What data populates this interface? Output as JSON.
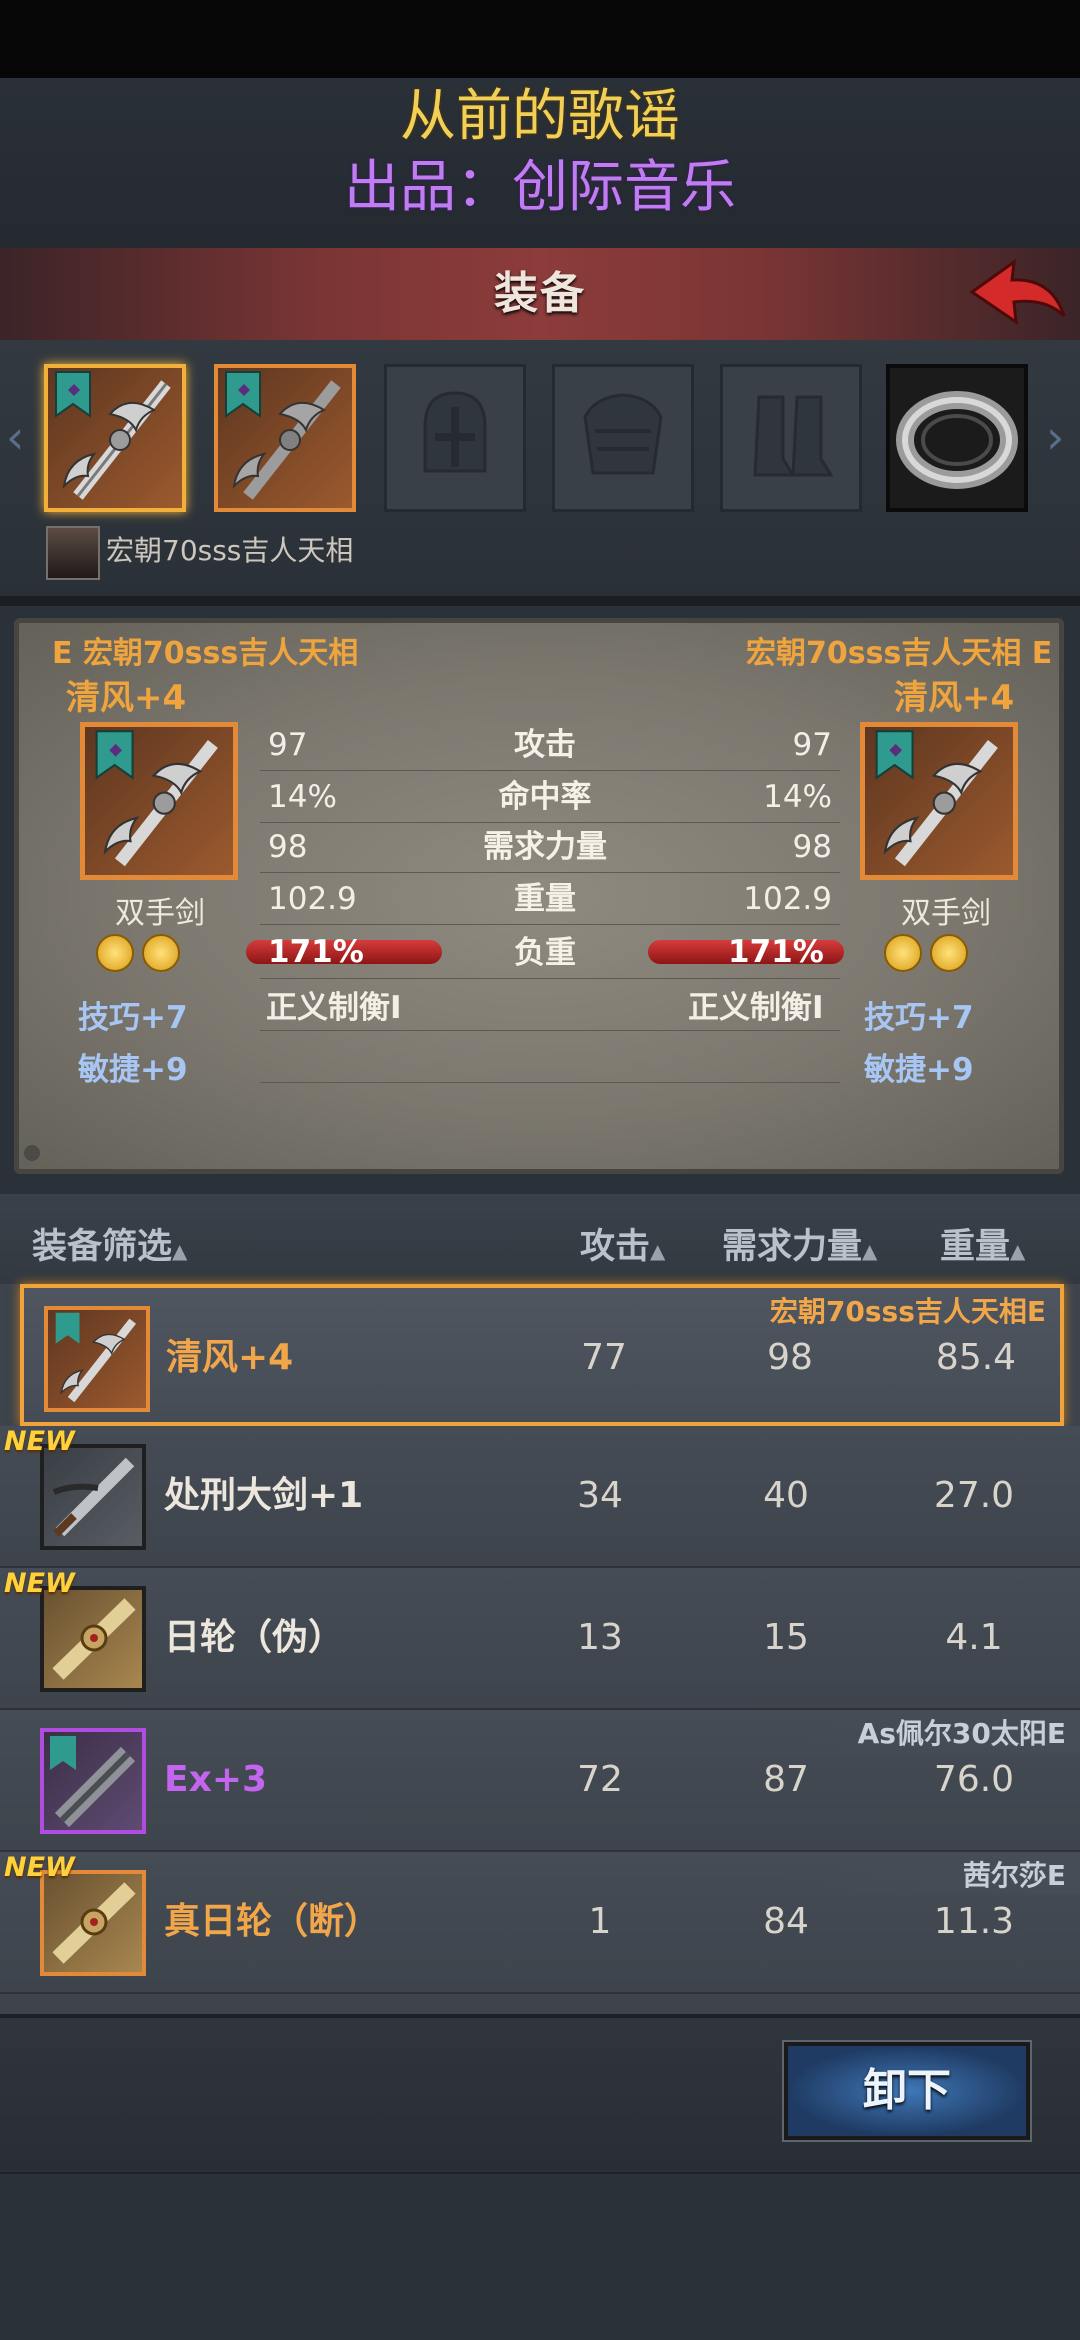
{
  "watermark": {
    "line1": "从前的歌谣",
    "line2": "出品：创际音乐"
  },
  "header": {
    "title": "装备",
    "back_icon": "red-back-arrow-icon"
  },
  "slots": [
    {
      "type": "weapon",
      "icon": "greatsword-icon",
      "selected": true
    },
    {
      "type": "weapon",
      "icon": "greatsword-icon",
      "selected": false
    },
    {
      "type": "empty",
      "icon": "helmet-icon"
    },
    {
      "type": "empty",
      "icon": "armor-icon"
    },
    {
      "type": "empty",
      "icon": "boots-icon"
    },
    {
      "type": "ring",
      "icon": "ring-icon"
    }
  ],
  "owner": {
    "name": "宏朝70sss吉人天相"
  },
  "compare": {
    "left": {
      "owner": "E 宏朝70sss吉人天相",
      "name": "清风+4",
      "type": "双手剑",
      "bonus1": "技巧+7",
      "bonus2": "敏捷+9",
      "load": "171%",
      "skill": "正义制衡Ⅰ"
    },
    "right": {
      "owner": "宏朝70sss吉人天相 E",
      "name": "清风+4",
      "type": "双手剑",
      "bonus1": "技巧+7",
      "bonus2": "敏捷+9",
      "load": "171%",
      "skill": "正义制衡Ⅰ"
    },
    "stats": [
      {
        "label": "攻击",
        "left": "97",
        "right": "97"
      },
      {
        "label": "命中率",
        "left": "14%",
        "right": "14%"
      },
      {
        "label": "需求力量",
        "left": "98",
        "right": "98"
      },
      {
        "label": "重量",
        "left": "102.9",
        "right": "102.9"
      },
      {
        "label": "负重"
      }
    ]
  },
  "list_header": {
    "filter": "装备筛选",
    "attack": "攻击",
    "str_req": "需求力量",
    "weight": "重量",
    "sort_icon": "sort-up-icon"
  },
  "items": [
    {
      "name": "清风+4",
      "attack": "77",
      "str_req": "98",
      "weight": "85.4",
      "owner": "宏朝70sss吉人天相E",
      "is_new": false,
      "selected": true,
      "rarity_color": "#e38a38",
      "name_color": "#f2a64a",
      "owner_color": "#f2a64a"
    },
    {
      "name": "处刑大剑+1",
      "attack": "34",
      "str_req": "40",
      "weight": "27.0",
      "owner": "",
      "is_new": true,
      "selected": false,
      "rarity_color": "#1f1f1f",
      "name_color": "#ece6dc",
      "owner_color": "#ece6dc"
    },
    {
      "name": "日轮（伪）",
      "attack": "13",
      "str_req": "15",
      "weight": "4.1",
      "owner": "",
      "is_new": true,
      "selected": false,
      "rarity_color": "#1f1f1f",
      "name_color": "#ece6dc",
      "owner_color": "#ece6dc"
    },
    {
      "name": "Ex+3",
      "attack": "72",
      "str_req": "87",
      "weight": "76.0",
      "owner": "As佩尔30太阳E",
      "is_new": false,
      "selected": false,
      "rarity_color": "#b14ce0",
      "name_color": "#c465ef",
      "owner_color": "#c9cfd6"
    },
    {
      "name": "真日轮（断）",
      "attack": "1",
      "str_req": "84",
      "weight": "11.3",
      "owner": "茜尔莎E",
      "is_new": true,
      "selected": false,
      "rarity_color": "#e38a38",
      "name_color": "#f2a64a",
      "owner_color": "#c9cfd6"
    }
  ],
  "new_badge": "NEW",
  "unequip_button": "卸下"
}
